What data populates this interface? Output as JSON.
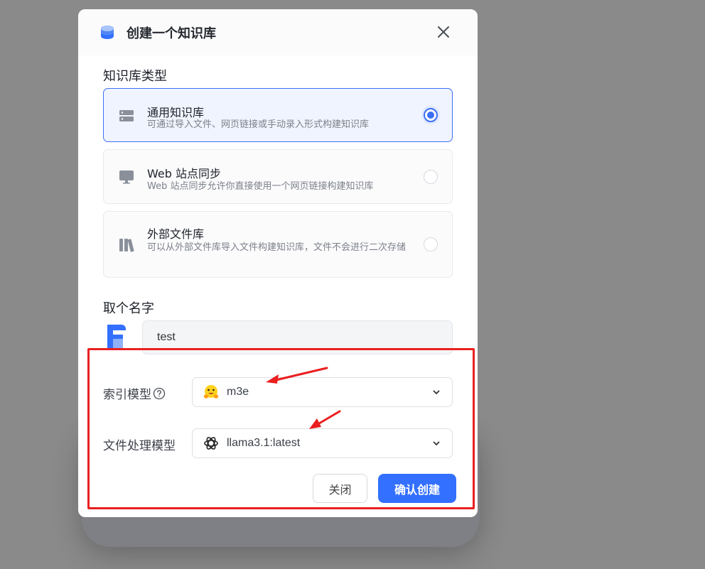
{
  "modal": {
    "title": "创建一个知识库"
  },
  "kb_type": {
    "label": "知识库类型",
    "options": [
      {
        "title": "通用知识库",
        "desc": "可通过导入文件、网页链接或手动录入形式构建知识库",
        "selected": true,
        "icon": "server-icon"
      },
      {
        "title": "Web 站点同步",
        "desc": "Web 站点同步允许你直接使用一个网页链接构建知识库",
        "selected": false,
        "icon": "monitor-icon"
      },
      {
        "title": "外部文件库",
        "desc": "可以从外部文件库导入文件构建知识库，文件不会进行二次存储",
        "selected": false,
        "icon": "books-icon"
      }
    ]
  },
  "name": {
    "label": "取个名字",
    "value": "test"
  },
  "index_model": {
    "label": "索引模型",
    "value": "m3e",
    "icon": "huggingface-icon"
  },
  "file_model": {
    "label": "文件处理模型",
    "value": "llama3.1:latest",
    "icon": "openai-icon"
  },
  "buttons": {
    "close": "关闭",
    "confirm": "确认创建"
  },
  "colors": {
    "accent": "#3370ff",
    "annotation": "#ea1f1f"
  }
}
